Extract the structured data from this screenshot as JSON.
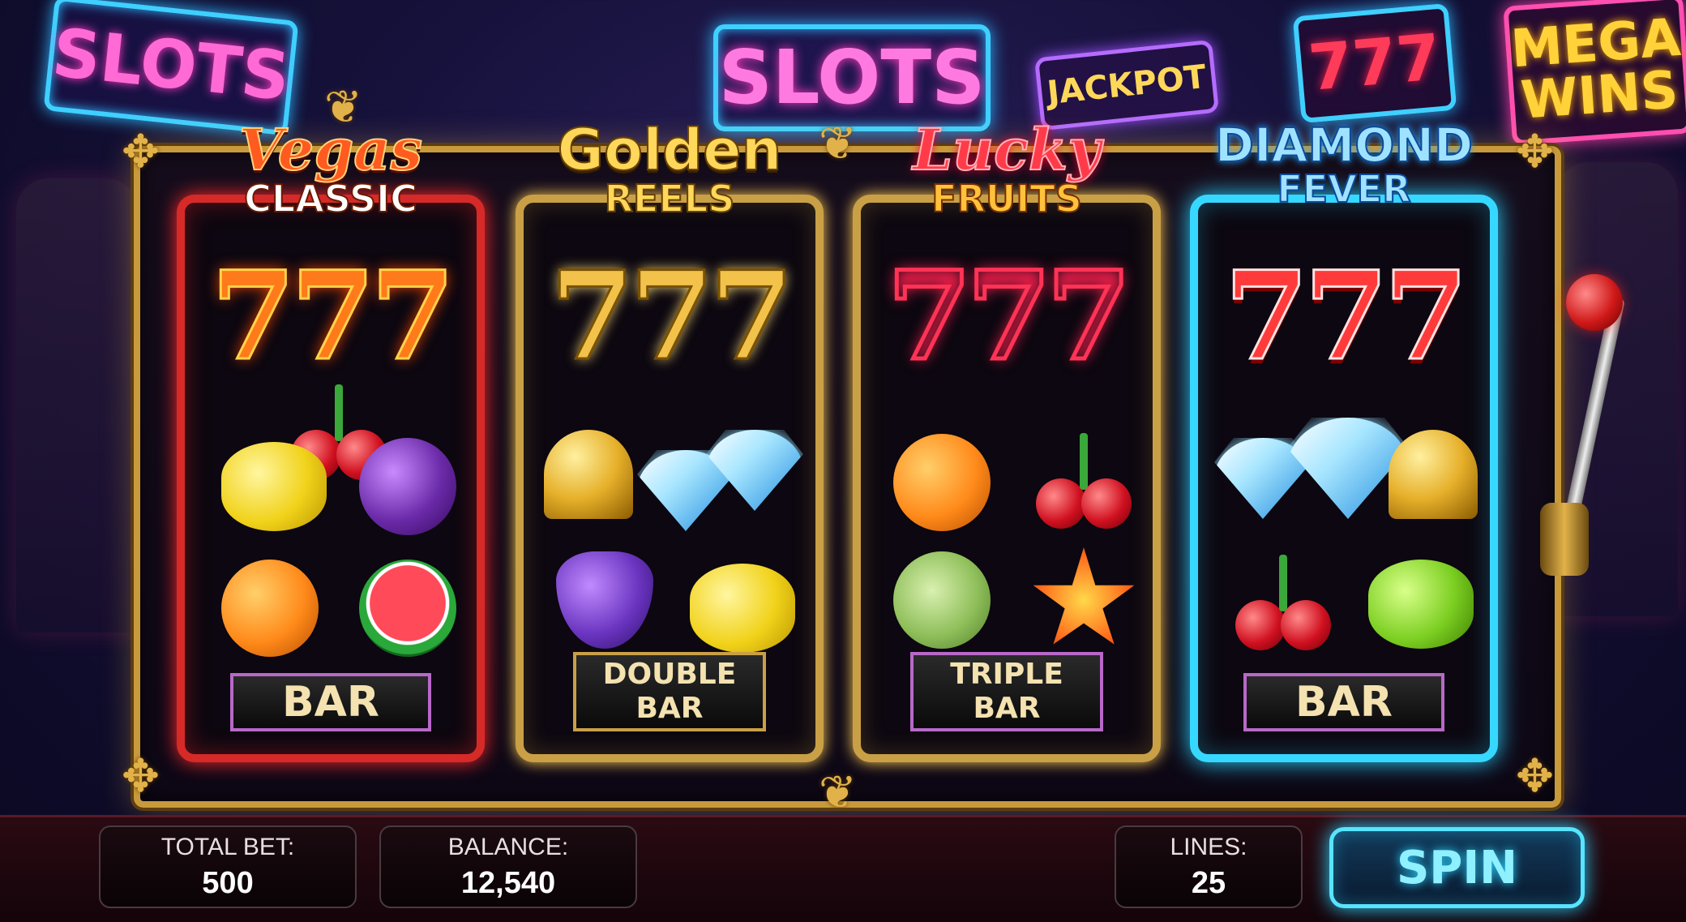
{
  "background_signs": {
    "slots_left": "SLOTS",
    "slots_center": "SLOTS",
    "jackpot": "JACKPOT",
    "sevens": "777",
    "mega_line1": "MEGA",
    "mega_line2": "WINS"
  },
  "reels": [
    {
      "title_line1": "Vegas",
      "title_line2": "CLASSIC",
      "sevens": "777",
      "symbols": [
        "cherry",
        "lemon",
        "plum",
        "orange",
        "watermelon"
      ],
      "bar_label": "BAR",
      "accent_color": "#d62a28"
    },
    {
      "title_line1": "Golden",
      "title_line2": "REELS",
      "sevens": "777",
      "symbols": [
        "bell",
        "diamond",
        "grapes",
        "lemon"
      ],
      "bar_line1": "DOUBLE",
      "bar_line2": "BAR",
      "accent_color": "#c9a046"
    },
    {
      "title_line1": "Lucky",
      "title_line2": "FRUITS",
      "sevens": "777",
      "symbols": [
        "orange",
        "cherry",
        "melon",
        "star"
      ],
      "bar_line1": "TRIPLE",
      "bar_line2": "BAR",
      "accent_color": "#c9a046"
    },
    {
      "title_line1": "DIAMOND",
      "title_line2": "FEVER",
      "sevens": "777",
      "symbols": [
        "diamond",
        "bell",
        "cherry",
        "lime"
      ],
      "bar_label": "BAR",
      "accent_color": "#37d8ff"
    }
  ],
  "footer": {
    "total_bet_label": "TOTAL BET:",
    "total_bet_value": "500",
    "balance_label": "BALANCE:",
    "balance_value": "12,540",
    "lines_label": "LINES:",
    "lines_value": "25",
    "spin_label": "SPIN"
  }
}
